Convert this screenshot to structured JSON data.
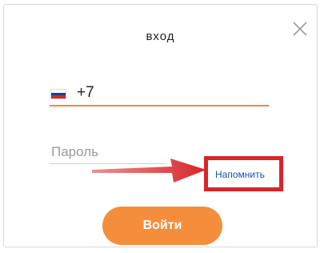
{
  "dialog": {
    "title": "вход",
    "close_icon": "close-icon"
  },
  "phone": {
    "country_flag_icon": "russia-flag-icon",
    "prefix": "+7"
  },
  "password": {
    "placeholder": "Пароль"
  },
  "remind": {
    "label": "Напомнить"
  },
  "login_button": {
    "label": "Войти"
  },
  "colors": {
    "accent": "#f48e3d",
    "active_underline": "#f0883a",
    "highlight": "#d7262a",
    "link": "#1a55a8"
  }
}
